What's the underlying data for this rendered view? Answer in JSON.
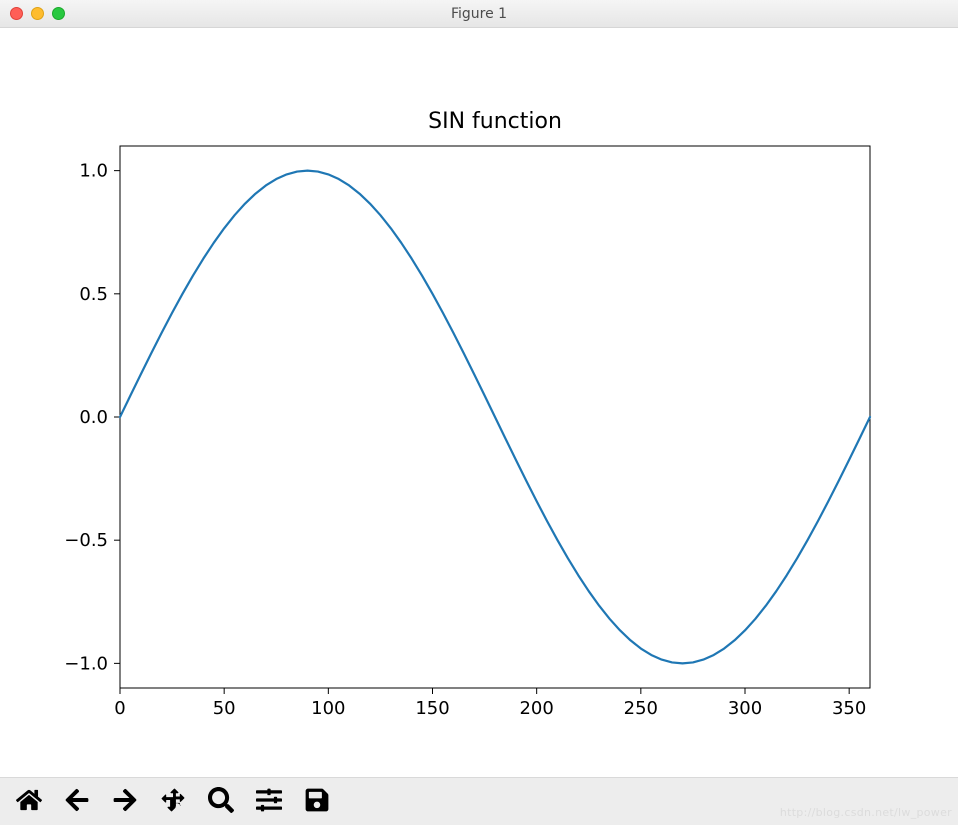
{
  "window": {
    "title": "Figure 1"
  },
  "chart_data": {
    "type": "line",
    "title": "SIN function",
    "xlabel": "",
    "ylabel": "",
    "xlim": [
      0,
      360
    ],
    "ylim": [
      -1.1,
      1.1
    ],
    "xticks": [
      0,
      50,
      100,
      150,
      200,
      250,
      300,
      350
    ],
    "yticks": [
      -1.0,
      -0.5,
      0.0,
      0.5,
      1.0
    ],
    "x": [
      0,
      5,
      10,
      15,
      20,
      25,
      30,
      35,
      40,
      45,
      50,
      55,
      60,
      65,
      70,
      75,
      80,
      85,
      90,
      95,
      100,
      105,
      110,
      115,
      120,
      125,
      130,
      135,
      140,
      145,
      150,
      155,
      160,
      165,
      170,
      175,
      180,
      185,
      190,
      195,
      200,
      205,
      210,
      215,
      220,
      225,
      230,
      235,
      240,
      245,
      250,
      255,
      260,
      265,
      270,
      275,
      280,
      285,
      290,
      295,
      300,
      305,
      310,
      315,
      320,
      325,
      330,
      335,
      340,
      345,
      350,
      355,
      360
    ],
    "values": [
      0.0,
      0.0872,
      0.1736,
      0.2588,
      0.342,
      0.4226,
      0.5,
      0.5736,
      0.6428,
      0.7071,
      0.766,
      0.8192,
      0.866,
      0.9063,
      0.9397,
      0.9659,
      0.9848,
      0.9962,
      1.0,
      0.9962,
      0.9848,
      0.9659,
      0.9397,
      0.9063,
      0.866,
      0.8192,
      0.766,
      0.7071,
      0.6428,
      0.5736,
      0.5,
      0.4226,
      0.342,
      0.2588,
      0.1736,
      0.0872,
      0.0,
      -0.0872,
      -0.1736,
      -0.2588,
      -0.342,
      -0.4226,
      -0.5,
      -0.5736,
      -0.6428,
      -0.7071,
      -0.766,
      -0.8192,
      -0.866,
      -0.9063,
      -0.9397,
      -0.9659,
      -0.9848,
      -0.9962,
      -1.0,
      -0.9962,
      -0.9848,
      -0.9659,
      -0.9397,
      -0.9063,
      -0.866,
      -0.8192,
      -0.766,
      -0.7071,
      -0.6428,
      -0.5736,
      -0.5,
      -0.4226,
      -0.342,
      -0.2588,
      -0.1736,
      -0.0872,
      0.0
    ],
    "line_color": "#1f77b4"
  },
  "toolbar": {
    "home_label": "Home",
    "back_label": "Back",
    "forward_label": "Forward",
    "pan_label": "Pan",
    "zoom_label": "Zoom",
    "configure_label": "Configure subplots",
    "save_label": "Save"
  },
  "watermark": "http://blog.csdn.net/lw_power"
}
